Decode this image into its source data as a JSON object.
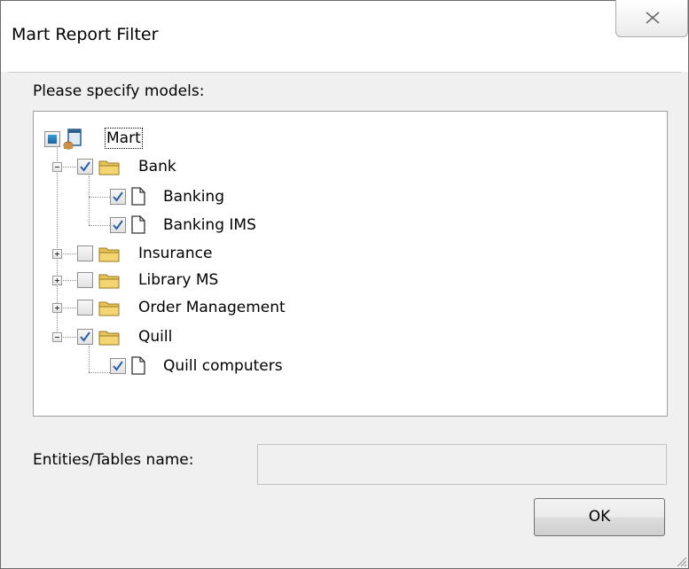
{
  "window": {
    "title": "Mart Report Filter"
  },
  "form": {
    "models_label": "Please specify models:",
    "entities_label": "Entities/Tables name:",
    "entities_value": "",
    "ok_label": "OK"
  },
  "tree": {
    "root": {
      "label": "Mart",
      "check": "partial",
      "icon": "mart-database-icon"
    },
    "nodes": [
      {
        "label": "Bank",
        "checked": true,
        "expanded": true,
        "icon": "folder-icon",
        "children": [
          {
            "label": "Banking",
            "checked": true,
            "icon": "document-icon"
          },
          {
            "label": "Banking IMS",
            "checked": true,
            "icon": "document-icon"
          }
        ]
      },
      {
        "label": "Insurance",
        "checked": false,
        "expanded": false,
        "icon": "folder-icon"
      },
      {
        "label": "Library MS",
        "checked": false,
        "expanded": false,
        "icon": "folder-icon"
      },
      {
        "label": "Order Management",
        "checked": false,
        "expanded": false,
        "icon": "folder-icon"
      },
      {
        "label": "Quill",
        "checked": true,
        "expanded": true,
        "icon": "folder-icon",
        "children": [
          {
            "label": "Quill computers",
            "checked": true,
            "icon": "document-icon"
          }
        ]
      }
    ]
  }
}
